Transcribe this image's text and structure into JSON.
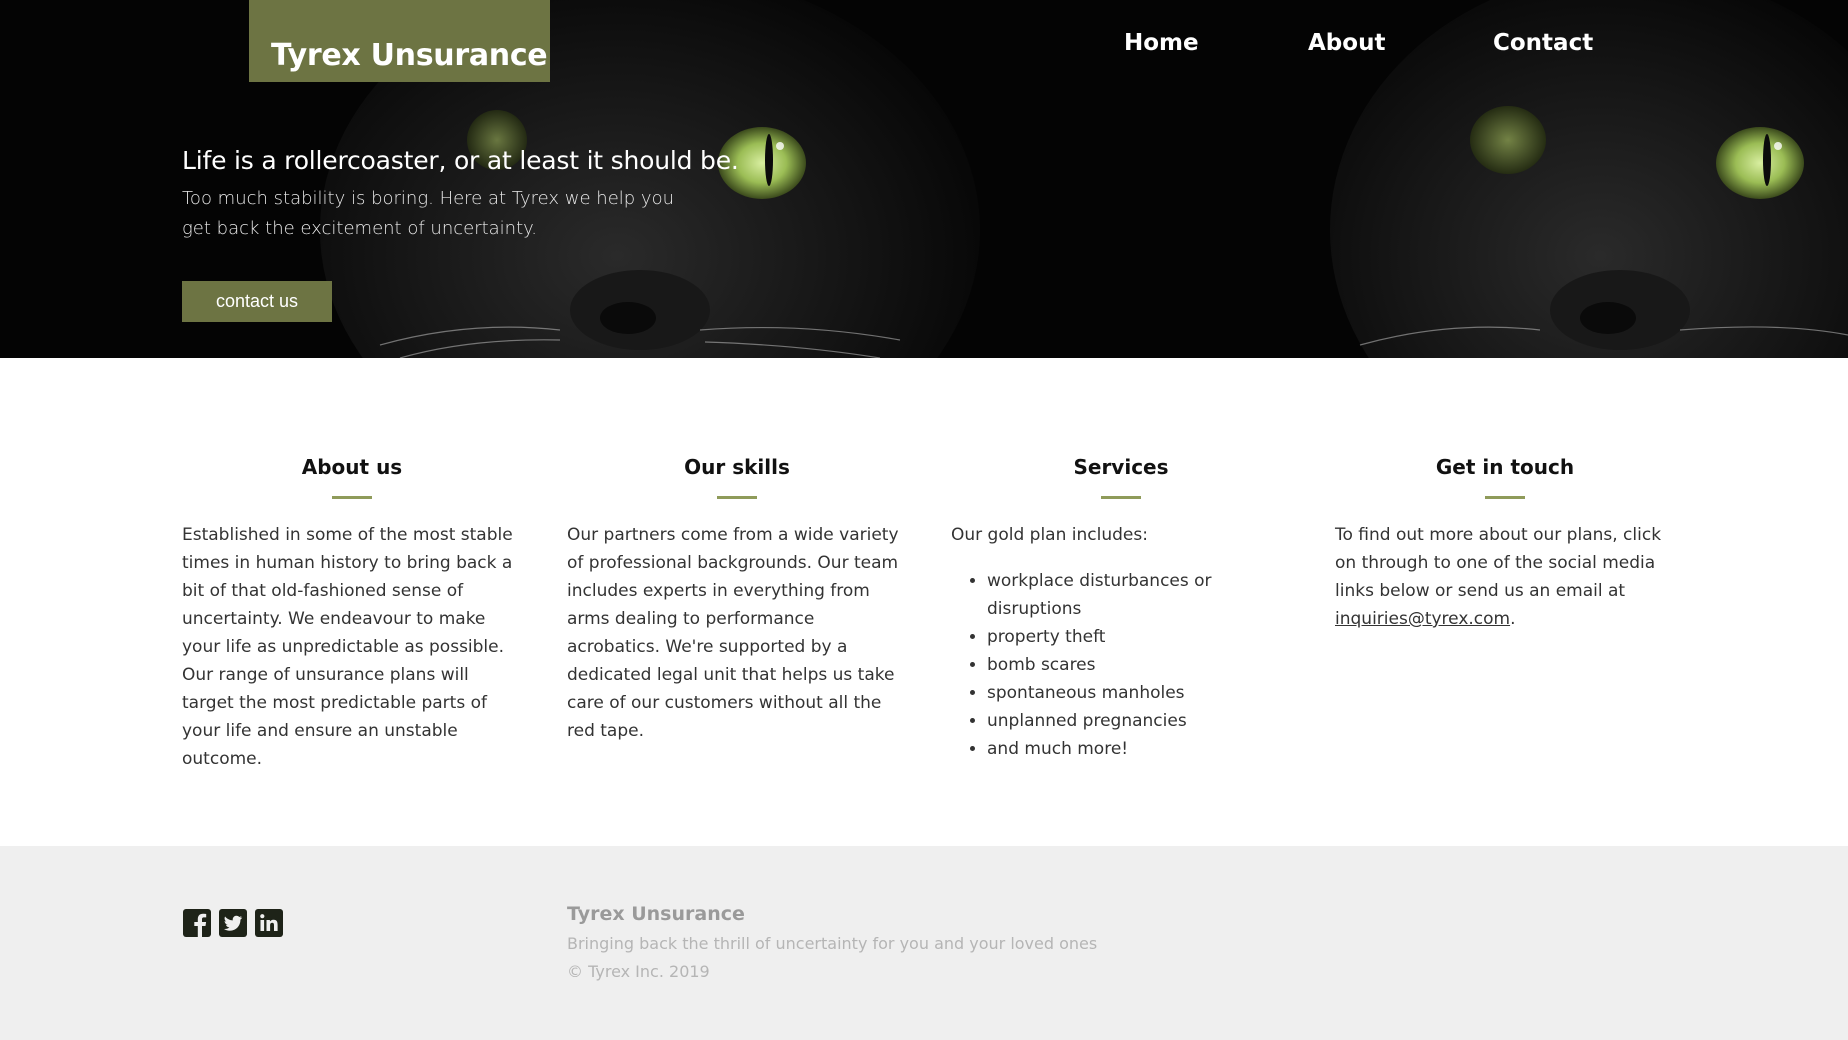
{
  "brand": {
    "name": "Tyrex Unsurance"
  },
  "nav": {
    "items": [
      "Home",
      "About",
      "Contact"
    ]
  },
  "hero": {
    "headline": "Life is a rollercoaster, or at least it should be.",
    "subtext": "Too much stability is boring. Here at Tyrex we help you get back the excitement of uncertainty.",
    "cta_label": "contact us"
  },
  "sections": {
    "about": {
      "title": "About us",
      "text": "Established in some of the most stable times in human history to bring back a bit of that old-fashioned sense of uncertainty. We endeavour to make your life as unpredictable as possible. Our range of unsurance plans will target the most predictable parts of your life and ensure an unstable outcome."
    },
    "skills": {
      "title": "Our skills",
      "text": "Our partners come from a wide variety of professional backgrounds. Our team includes experts in everything from arms dealing to performance acrobatics. We're supported by a dedicated legal unit that helps us take care of our customers without all the red tape."
    },
    "services": {
      "title": "Services",
      "intro": "Our gold plan includes:",
      "items": [
        "workplace disturbances or disruptions",
        "property theft",
        "bomb scares",
        "spontaneous manholes",
        "unplanned pregnancies",
        "and much more!"
      ]
    },
    "contact": {
      "title": "Get in touch",
      "text": "To find out more about our plans, click on through to one of the social media links below or send us an email at",
      "email": "inquiries@tyrex.com",
      "suffix": "."
    }
  },
  "footer": {
    "name": "Tyrex Unsurance",
    "tagline": "Bringing back the thrill of uncertainty for you and your loved ones",
    "copyright": "© Tyrex Inc. 2019",
    "social_icons": [
      "facebook-icon",
      "twitter-icon",
      "linkedin-icon"
    ]
  },
  "colors": {
    "accent": "#6d7443",
    "rule": "#8f9b5a",
    "hero_bg": "#050505",
    "footer_bg": "#efefef"
  }
}
